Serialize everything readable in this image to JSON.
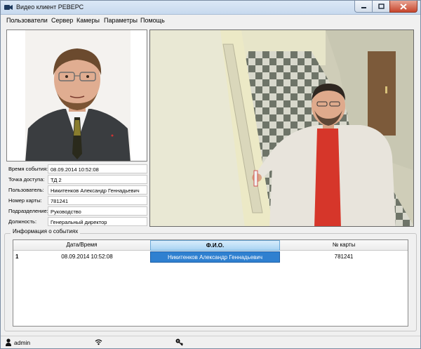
{
  "window": {
    "title": "Видео клиент РЕВЕРС"
  },
  "menu": {
    "items": [
      "Пользователи",
      "Сервер",
      "Камеры",
      "Параметры",
      "Помощь"
    ]
  },
  "event_info": {
    "fields": [
      {
        "label": "Время события:",
        "value": "08.09.2014 10:52:08"
      },
      {
        "label": "Точка доступа:",
        "value": "ТД 2"
      },
      {
        "label": "Пользователь:",
        "value": "Никитенков Александр Геннадьевич"
      },
      {
        "label": "Номер карты:",
        "value": "781241"
      },
      {
        "label": "Подразделение:",
        "value": "Руководство"
      },
      {
        "label": "Должность:",
        "value": "Генеральный директор"
      }
    ]
  },
  "events": {
    "group_title": "Информация о событиях",
    "columns": [
      "Дата/Время",
      "Ф.И.О.",
      "№ карты"
    ],
    "sorted_column": "Ф.И.О.",
    "rows": [
      {
        "index": "1",
        "datetime": "08.09.2014 10:52:08",
        "name": "Никитенков Александр Геннадьевич",
        "card": "781241"
      }
    ]
  },
  "statusbar": {
    "user": "admin"
  },
  "colors": {
    "selection": "#2f80d0",
    "sorted_header": "#a9d4f3",
    "titlebar": "#c7d9ee"
  }
}
